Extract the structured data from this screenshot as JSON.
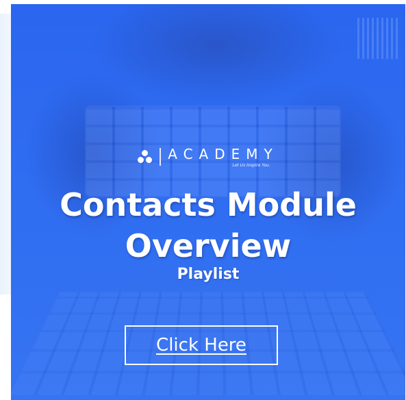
{
  "banner": {
    "logo": {
      "icon": "academy-logo-icon",
      "name": "ACADEMY",
      "tagline": "Let Us Inspire You."
    },
    "title_line1": "Contacts Module",
    "title_line2": "Overview",
    "subtitle": "Playlist",
    "cta_label": "Click Here"
  },
  "colors": {
    "banner_blue": "#2e6cf0",
    "text": "#ffffff"
  }
}
